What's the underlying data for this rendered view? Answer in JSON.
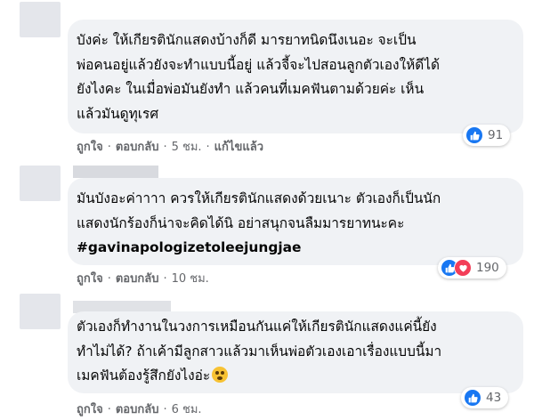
{
  "comments": [
    {
      "lines": [
        "บังค่ะ ให้เกียรตินักแสดงบ้างก็ดี มารยาทนิดนึงเนอะ จะเป็น",
        "พ่อคนอยู่แล้วยังจะทำแบบนี้อยู่ แล้วจี้จะไปสอนลูกตัวเองให้ดีได้",
        "ยังไงคะ ในเมื่อพ่อมันยังทำ แล้วคนที่เมคฟันตามด้วยค่ะ เห็น",
        "แล้วมันดูทุเรศ"
      ],
      "like_label": "ถูกใจ",
      "reply_label": "ตอบกลับ",
      "time": "5 ชม.",
      "edited_label": "แก้ไขแล้ว",
      "reaction_count": "91"
    },
    {
      "lines": [
        "มันบังอะค่าาาา ควรให้เกียรตินักแสดงด้วยเนาะ ตัวเองก็เป็นนัก",
        "แสดงนักร้องก็น่าจะคิดได้นิ อย่าสนุกจนลืมมารยาทนะคะ"
      ],
      "hashtag": "#gavinapologizetoleejungjae",
      "like_label": "ถูกใจ",
      "reply_label": "ตอบกลับ",
      "time": "10 ชม.",
      "reaction_count": "190"
    },
    {
      "lines": [
        "ตัวเองก็ทำงานในวงการเหมือนกันแค่ให้เกียรตินักแสดงแค่นี้ยัง",
        "ทำไม่ได้? ถ้าเค้ามีลูกสาวแล้วมาเห็นพ่อตัวเองเอาเรื่องแบบนี้มา",
        "เมคฟันต้องรู้สึกยังไงอ่ะ"
      ],
      "like_label": "ถูกใจ",
      "reply_label": "ตอบกลับ",
      "time": "6 ชม.",
      "reaction_count": "43"
    }
  ],
  "icons": {
    "like": "thumbs-up-icon",
    "love": "heart-icon",
    "emoji": "flushed-face-emoji"
  },
  "colors": {
    "like": "#1877f2",
    "love": "#f33e58",
    "bubble": "#f0f2f5",
    "meta_text": "#65676b"
  }
}
